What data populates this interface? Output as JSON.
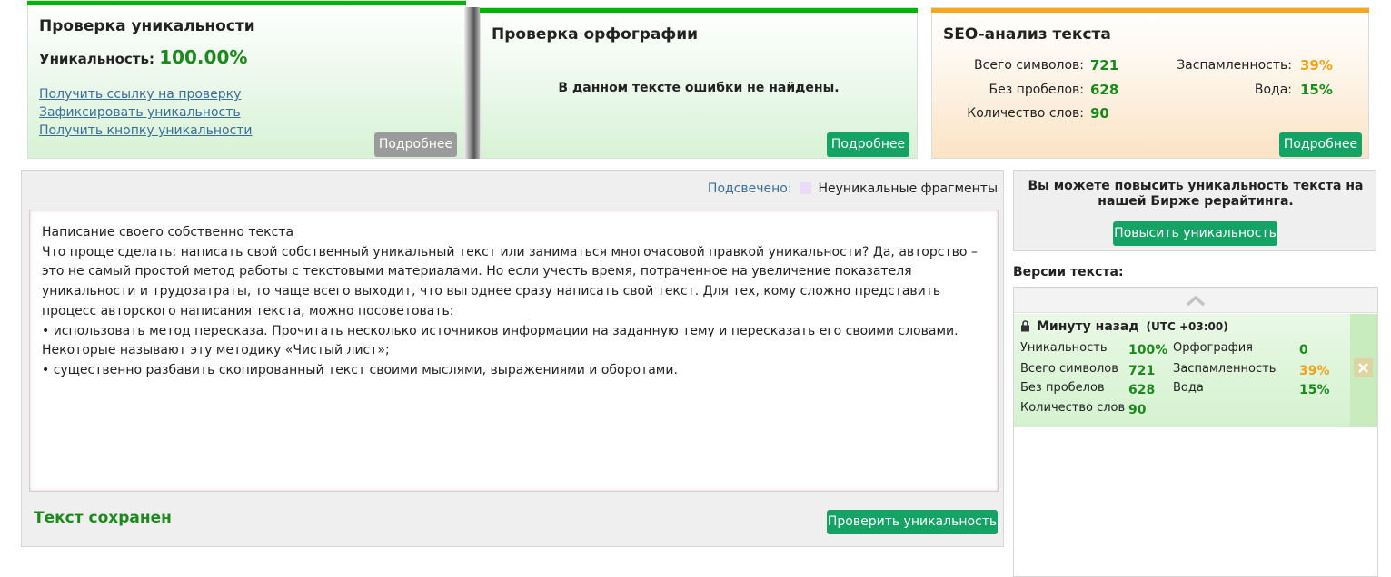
{
  "uniqueness_card": {
    "title": "Проверка уникальности",
    "label": "Уникальность:",
    "value": "100.00%",
    "links": [
      "Получить ссылку на проверку",
      "Зафиксировать уникальность",
      "Получить кнопку уникальности"
    ],
    "details_button": "Подробнее",
    "accent_color": "#00b300"
  },
  "spelling_card": {
    "title": "Проверка орфографии",
    "message": "В данном тексте ошибки не найдены.",
    "details_button": "Подробнее"
  },
  "seo_card": {
    "title": "SEO-анализ текста",
    "total_chars_label": "Всего символов:",
    "total_chars": "721",
    "no_spaces_label": "Без пробелов:",
    "no_spaces": "628",
    "words_label": "Количество слов:",
    "words": "90",
    "spam_label": "Заспамленность:",
    "spam": "39%",
    "water_label": "Вода:",
    "water": "15%",
    "details_button": "Подробнее",
    "accent_color": "#f5a623"
  },
  "editor": {
    "highlight_label": "Подсвечено:",
    "highlight_legend": "Неуникальные фрагменты",
    "lines": [
      "Написание своего собственно текста",
      "Что проще сделать: написать свой собственный уникальный текст или заниматься многочасовой правкой уникальности? Да, авторство – это не самый простой метод работы с текстовыми материалами.  Но если учесть время, потраченное на увеличение показателя уникальности и трудозатраты, то чаще всего выходит, что выгоднее сразу написать свой текст. Для тех, кому сложно представить процесс авторского написания текста, можно посоветовать:",
      "• использовать метод пересказа. Прочитать несколько источников информации на заданную тему и пересказать его своими словами. Некоторые называют эту методику «Чистый лист»;",
      "• существенно разбавить скопированный текст своими мыслями, выражениями и оборотами."
    ],
    "status": "Текст сохранен",
    "check_button": "Проверить уникальность"
  },
  "promo": {
    "text": "Вы можете повысить уникальность текста на нашей Бирже рерайтинга.",
    "button": "Повысить уникальность"
  },
  "versions": {
    "title": "Версии текста:",
    "entry": {
      "time": "Минуту назад",
      "tz": "(UTC +03:00)",
      "uniq_label": "Уникальность",
      "uniq": "100%",
      "spelling_label": "Орфография",
      "spelling": "0",
      "chars_label": "Всего символов",
      "chars": "721",
      "spam_label": "Заспамленность",
      "spam": "39%",
      "nospace_label": "Без пробелов",
      "nospace": "628",
      "water_label": "Вода",
      "water": "15%",
      "words_label": "Количество слов",
      "words": "90"
    }
  }
}
